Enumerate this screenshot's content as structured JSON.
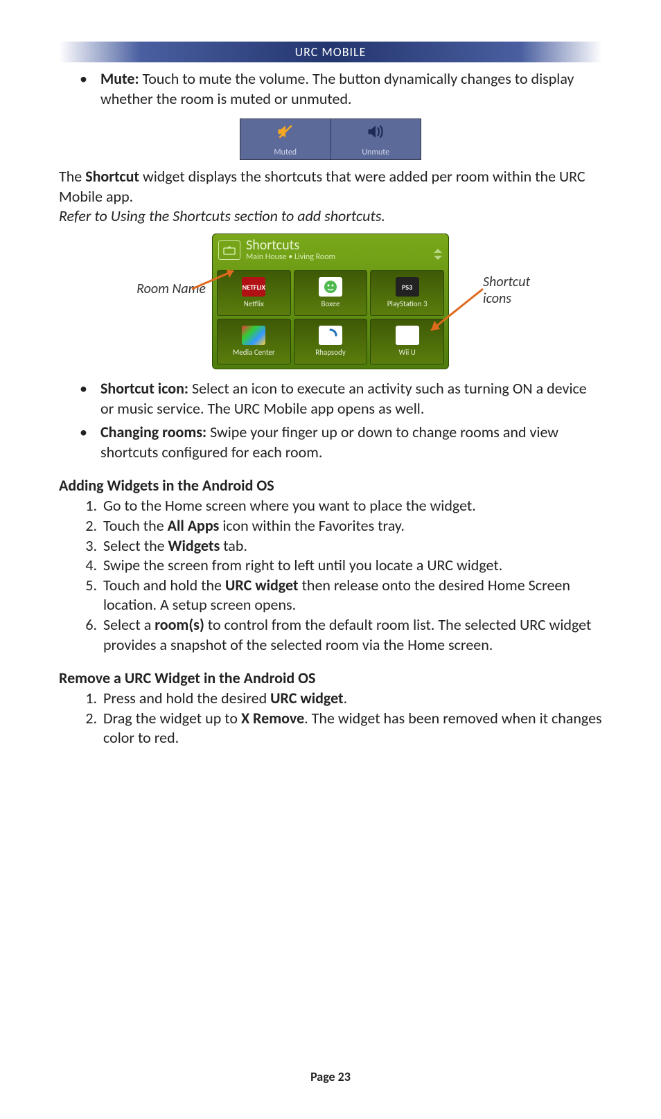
{
  "header": {
    "title": "URC MOBILE"
  },
  "mute_section": {
    "bullet_label": "Mute:",
    "bullet_text": " Touch to mute the volume.  The button dynamically changes to display whether the room is muted or unmuted."
  },
  "mute_widget": {
    "muted_label": "Muted",
    "unmute_label": "Unmute"
  },
  "shortcut_intro": {
    "line_a_pre": "The ",
    "line_a_bold": "Shortcut",
    "line_a_post": " widget displays the shortcuts that were added per room within the URC Mobile app.",
    "refer": "Refer to Using the Shortcuts section to add shortcuts."
  },
  "shortcut_widget": {
    "title": "Shortcuts",
    "subtitle": "Main House • Living Room",
    "items": [
      {
        "label": "Netflix",
        "icon_text": "NETFLIX"
      },
      {
        "label": "Boxee",
        "icon_text": ""
      },
      {
        "label": "PlayStation 3",
        "icon_text": "PS3"
      },
      {
        "label": "Media Center",
        "icon_text": ""
      },
      {
        "label": "Rhapsody",
        "icon_text": ""
      },
      {
        "label": "Wii U",
        "icon_text": "Wii U"
      }
    ],
    "callout_left": "Room Name",
    "callout_right": "Shortcut icons"
  },
  "shortcut_bullets": {
    "b1_label": "Shortcut icon:",
    "b1_text": " Select an icon to execute an activity such as turning ON a device or music service.  The URC Mobile app opens as well.",
    "b2_label": "Changing rooms:",
    "b2_text": " Swipe your finger up or down to change rooms and view shortcuts configured for each room."
  },
  "adding": {
    "heading": "Adding Widgets in the Android OS",
    "s1": "Go to the Home screen where you want to place the widget.",
    "s2_pre": "Touch the ",
    "s2_bold": "All Apps",
    "s2_post": " icon within the Favorites tray.",
    "s3_pre": "Select the ",
    "s3_bold": "Widgets",
    "s3_post": " tab.",
    "s4": "Swipe the screen from right to left until you locate a URC widget.",
    "s5_pre": "Touch and hold the ",
    "s5_bold": "URC widget",
    "s5_post": " then release onto the desired Home Screen location. A setup screen opens.",
    "s6_pre": "Select a ",
    "s6_bold": "room(s)",
    "s6_post": " to control from the default room list.  The selected URC widget provides a snapshot of the selected room via the Home screen."
  },
  "remove": {
    "heading": "Remove a URC Widget in the Android OS",
    "s1_pre": "Press and hold the desired ",
    "s1_bold": "URC widget",
    "s1_post": ".",
    "s2_pre": "Drag the widget up to ",
    "s2_bold": "X Remove",
    "s2_post": ".  The widget has been removed when it changes color to red."
  },
  "footer": {
    "page": "Page 23"
  }
}
